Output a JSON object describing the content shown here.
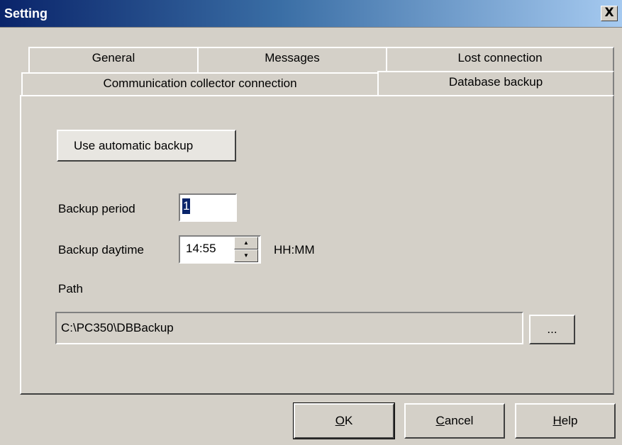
{
  "window": {
    "title": "Setting",
    "close_symbol": "X"
  },
  "tabs": {
    "row1": [
      "General",
      "Messages",
      "Lost connection"
    ],
    "row2": [
      "Communication collector connection",
      "Database backup"
    ],
    "active": "Database backup"
  },
  "panel": {
    "auto_backup_label": "Use automatic backup",
    "backup_period_label": "Backup period",
    "backup_period_value": "1",
    "backup_daytime_label": "Backup daytime",
    "backup_daytime_value": "14:55",
    "time_format": "HH:MM",
    "path_label": "Path",
    "path_value": "C:\\PC350\\DBBackup",
    "browse_label": "..."
  },
  "buttons": {
    "ok": {
      "mnemonic": "O",
      "rest": "K"
    },
    "cancel": {
      "mnemonic": "C",
      "rest": "ancel"
    },
    "help": {
      "mnemonic": "H",
      "rest": "elp"
    }
  }
}
